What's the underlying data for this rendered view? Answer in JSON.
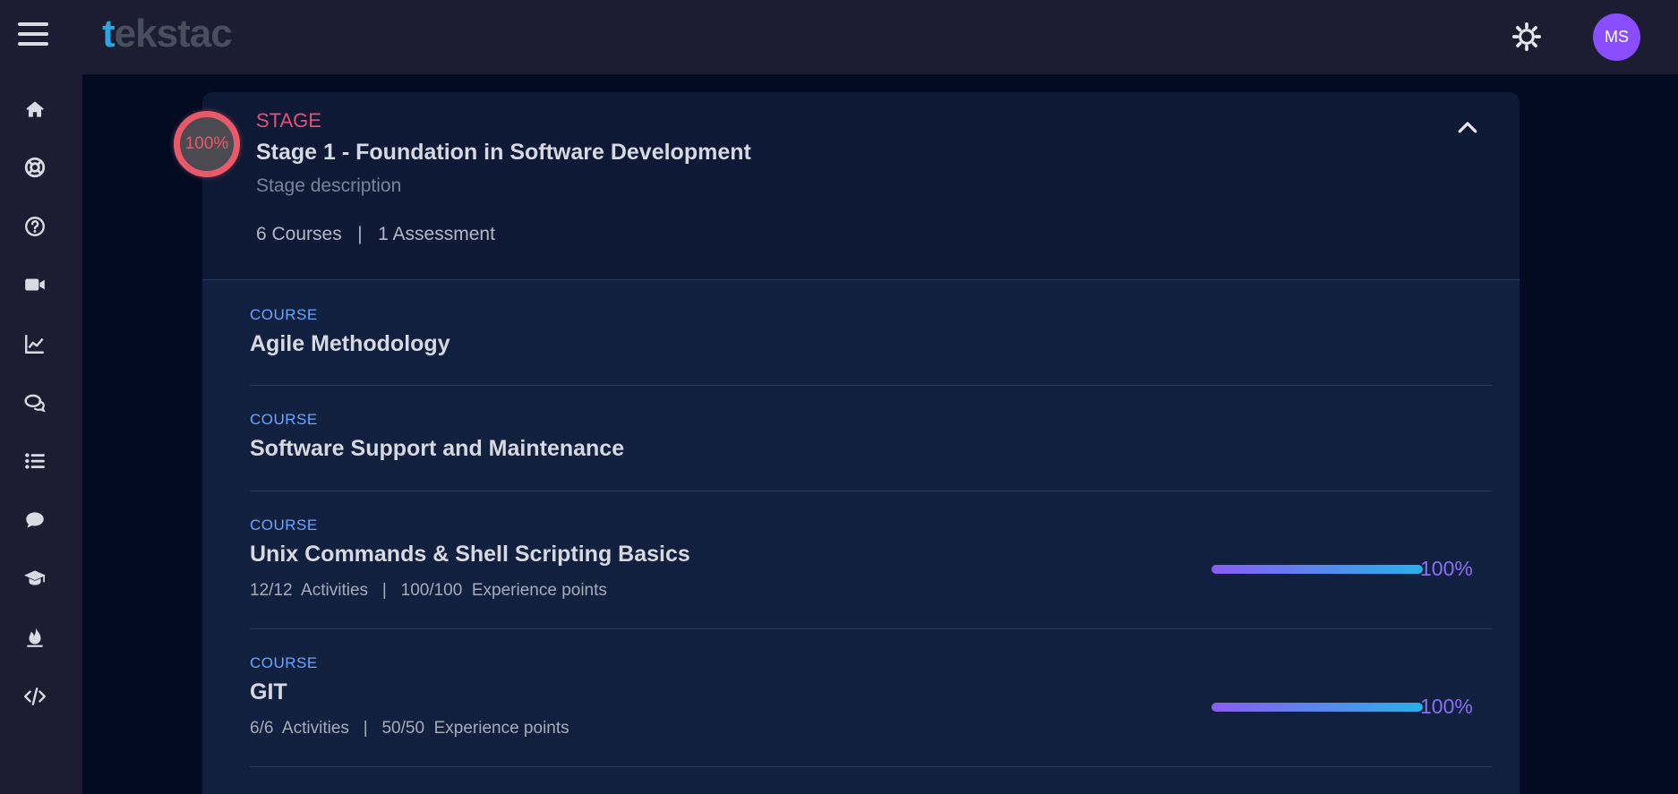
{
  "app": {
    "logo_t": "t",
    "logo_rest": "ekstac"
  },
  "header": {
    "avatar_initials": "MS"
  },
  "sidebar": {
    "icons": [
      "home-icon",
      "lifebuoy-icon",
      "help-icon",
      "video-icon",
      "chart-line-icon",
      "chat-bubbles-icon",
      "list-icon",
      "comment-icon",
      "graduation-cap-icon",
      "fire-icon",
      "code-icon"
    ]
  },
  "stage": {
    "progress": "100%",
    "progress_value": 1.0,
    "tag": "STAGE",
    "title": "Stage 1 - Foundation in Software Development",
    "description": "Stage description",
    "meta": "6 Courses   |   1 Assessment"
  },
  "courses": [
    {
      "tag": "COURSE",
      "title": "Agile Methodology"
    },
    {
      "tag": "COURSE",
      "title": "Software Support and Maintenance"
    },
    {
      "tag": "COURSE",
      "title": "Unix Commands & Shell Scripting Basics",
      "meta": "12/12  Activities   |   100/100  Experience points",
      "progress": "100%",
      "progress_value": 1.0
    },
    {
      "tag": "COURSE",
      "title": "GIT",
      "meta": "6/6  Activities   |   50/50  Experience points",
      "progress": "100%",
      "progress_value": 1.0
    }
  ],
  "colors": {
    "accent_stage": "#e0527a",
    "accent_course": "#6aa5ff",
    "progress_start": "#8a5df0",
    "progress_end": "#2ab0e8",
    "avatar": "#8a4dff"
  }
}
